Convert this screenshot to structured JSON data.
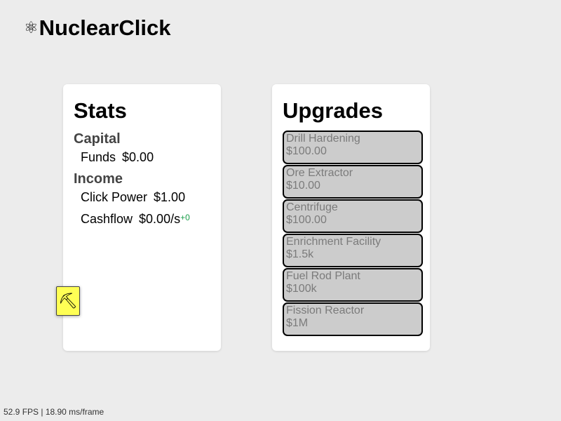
{
  "app": {
    "title": "NuclearClick",
    "logo_icon": "⚛"
  },
  "stats": {
    "heading": "Stats",
    "capital_heading": "Capital",
    "funds_label": "Funds",
    "funds_value": "$0.00",
    "income_heading": "Income",
    "click_power_label": "Click Power",
    "click_power_value": "$1.00",
    "cashflow_label": "Cashflow",
    "cashflow_value": "$0.00/s",
    "cashflow_delta": "+0",
    "delta_color": "#1a9e4a"
  },
  "mine_button": {
    "icon": "⛏",
    "color": "#ffff55"
  },
  "upgrades": {
    "heading": "Upgrades",
    "items": [
      {
        "name": "Drill Hardening",
        "cost": "$100.00"
      },
      {
        "name": "Ore Extractor",
        "cost": "$10.00"
      },
      {
        "name": "Centrifuge",
        "cost": "$100.00"
      },
      {
        "name": "Enrichment Facility",
        "cost": "$1.5k"
      },
      {
        "name": "Fuel Rod Plant",
        "cost": "$100k"
      },
      {
        "name": "Fission Reactor",
        "cost": "$1M"
      }
    ]
  },
  "footer": {
    "fps_text": "52.9 FPS | 18.90 ms/frame"
  }
}
